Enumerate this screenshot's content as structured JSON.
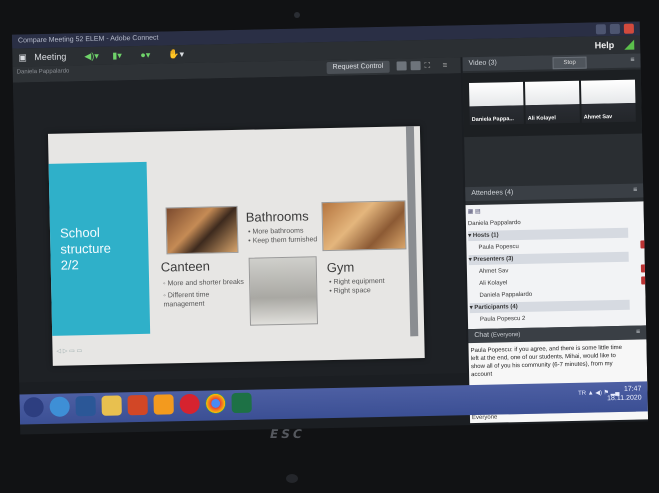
{
  "window": {
    "title": "Compare Meeting 52 ELEM - Adobe Connect",
    "menu": [
      "Meeting"
    ],
    "help": "Help"
  },
  "toolbar": {
    "crumb": "Daniela Pappalardo",
    "request_control": "Request Control"
  },
  "slide": {
    "title": "School\nstructure\n2/2",
    "bathrooms": {
      "heading": "Bathrooms",
      "bullets": [
        "More bathrooms",
        "Keep them furnished"
      ]
    },
    "canteen": {
      "heading": "Canteen",
      "bullets": [
        "More and shorter breaks",
        "Different time management"
      ]
    },
    "gym": {
      "heading": "Gym",
      "bullets": [
        "Right equipment",
        "Right space"
      ]
    }
  },
  "video": {
    "label": "Video (3)",
    "stop": "Stop",
    "tiles": [
      "Daniela Pappa...",
      "Ali Kolayel",
      "Ahmet Sav"
    ]
  },
  "attendees": {
    "label": "Attendees (4)",
    "current": "Daniela Pappalardo",
    "groups": [
      {
        "name": "Hosts (1)",
        "members": [
          "Paula Popescu"
        ]
      },
      {
        "name": "Presenters (3)",
        "members": [
          "Ahmet Sav",
          "Ali Kolayel",
          "Daniela Pappalardo"
        ]
      },
      {
        "name": "Participants (4)",
        "members": [
          "Paula Popescu 2"
        ]
      }
    ]
  },
  "chat": {
    "label": "Chat",
    "scope": "(Everyone)",
    "message": "Paula Popescu: if you agree, and there is some little time left at the end, one of our students, Mihai, would like to show all of you his community (6-7 minutes), from my account",
    "recipient": "Everyone"
  },
  "taskbar": {
    "tray": "TR",
    "time": "17:47",
    "date": "18.11.2020"
  },
  "brand": "ESC"
}
